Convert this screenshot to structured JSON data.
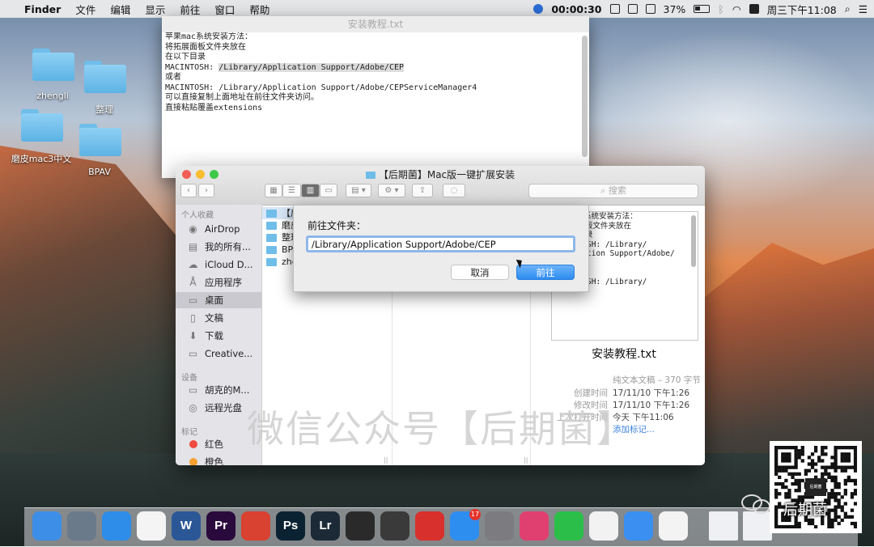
{
  "menubar": {
    "app_name": "Finder",
    "items": [
      "文件",
      "编辑",
      "显示",
      "前往",
      "窗口",
      "帮助"
    ],
    "record_time": "00:00:30",
    "battery": "37%",
    "clock": "周三下午11:08"
  },
  "desktop_icons": [
    {
      "label": "zhengli"
    },
    {
      "label": "整理"
    },
    {
      "label": "磨皮mac3中文"
    },
    {
      "label": "BPAV"
    }
  ],
  "textedit": {
    "title": "安装教程.txt",
    "lines": [
      "苹果mac系统安装方法：",
      "",
      "",
      "将拓展面板文件夹放在",
      "",
      "在以下目录",
      "",
      "MACINTOSH: /Library/Application Support/Adobe/CEP",
      "或者",
      "",
      "MACINTOSH: /Library/Application Support/Adobe/CEPServiceManager4",
      "可以直接复制上面地址在前往文件夹访问。",
      "",
      "直接粘贴覆盖extensions"
    ]
  },
  "finder": {
    "title": "【后期菌】Mac版一键扩展安装",
    "search_placeholder": "搜索",
    "sidebar": {
      "favorites_header": "个人收藏",
      "favorites": [
        "AirDrop",
        "我的所有...",
        "iCloud D...",
        "应用程序",
        "桌面",
        "文稿",
        "下载",
        "Creative..."
      ],
      "devices_header": "设备",
      "devices": [
        "胡克的M...",
        "远程光盘"
      ],
      "tags_header": "标记",
      "tags": [
        {
          "label": "红色",
          "color": "#f04a3e"
        },
        {
          "label": "橙色",
          "color": "#f5a030"
        }
      ]
    },
    "column1": [
      "【后",
      "磨皮",
      "整理",
      "BPA",
      "zhe"
    ],
    "preview": {
      "lines": [
        "苹果mac系统安装方法：",
        "",
        "将拓展面板文件夹放在",
        "",
        "在以下目录",
        "",
        "MACINTOSH: /Library/",
        "Application Support/Adobe/",
        "CEP",
        "或者",
        "",
        "MACINTOSH: /Library/"
      ],
      "filename": "安装教程.txt",
      "kind": "纯文本文稿 – 370 字节",
      "created_label": "创建时间",
      "created": "17/11/10 下午1:26",
      "modified_label": "修改时间",
      "modified": "17/11/10 下午1:26",
      "opened_label": "上次打开时间",
      "opened": "今天 下午11:06",
      "add_tags": "添加标记..."
    }
  },
  "goto_sheet": {
    "label": "前往文件夹：",
    "path": "/Library/Application Support/Adobe/CEP",
    "cancel": "取消",
    "go": "前往"
  },
  "watermark": "微信公众号【后期菌】",
  "qr_label": "后期菌",
  "qr_center": "后期菌",
  "dock_apps": [
    {
      "name": "Finder",
      "text": "",
      "color": "#3d8ee6"
    },
    {
      "name": "Launchpad",
      "text": "",
      "color": "#6b7a8a"
    },
    {
      "name": "Safari",
      "text": "",
      "color": "#2d8de8"
    },
    {
      "name": "Photos",
      "text": "",
      "color": "#f4f4f4"
    },
    {
      "name": "Word",
      "text": "W",
      "color": "#2b5797"
    },
    {
      "name": "Premiere",
      "text": "Pr",
      "color": "#2a0a3c"
    },
    {
      "name": "Recorder",
      "text": "",
      "color": "#d94130"
    },
    {
      "name": "Photoshop",
      "text": "Ps",
      "color": "#0b2233"
    },
    {
      "name": "Lightroom",
      "text": "Lr",
      "color": "#1c2a38"
    },
    {
      "name": "Final Cut",
      "text": "",
      "color": "#2a2a2a"
    },
    {
      "name": "QuickTime",
      "text": "",
      "color": "#3a3a3a"
    },
    {
      "name": "NetEase Music",
      "text": "",
      "color": "#d8302c"
    },
    {
      "name": "App Store",
      "text": "",
      "color": "#2e8ef0"
    },
    {
      "name": "Preferences",
      "text": "",
      "color": "#7b7b80"
    },
    {
      "name": "Display",
      "text": "",
      "color": "#e04070"
    },
    {
      "name": "FaceTime",
      "text": "",
      "color": "#2bbf4a"
    },
    {
      "name": "Baidu",
      "text": "",
      "color": "#f2f2f2"
    },
    {
      "name": "Zoom",
      "text": "",
      "color": "#3a8ff0"
    },
    {
      "name": "Notes",
      "text": "",
      "color": "#f3f3f3"
    }
  ],
  "appstore_badge": "17"
}
